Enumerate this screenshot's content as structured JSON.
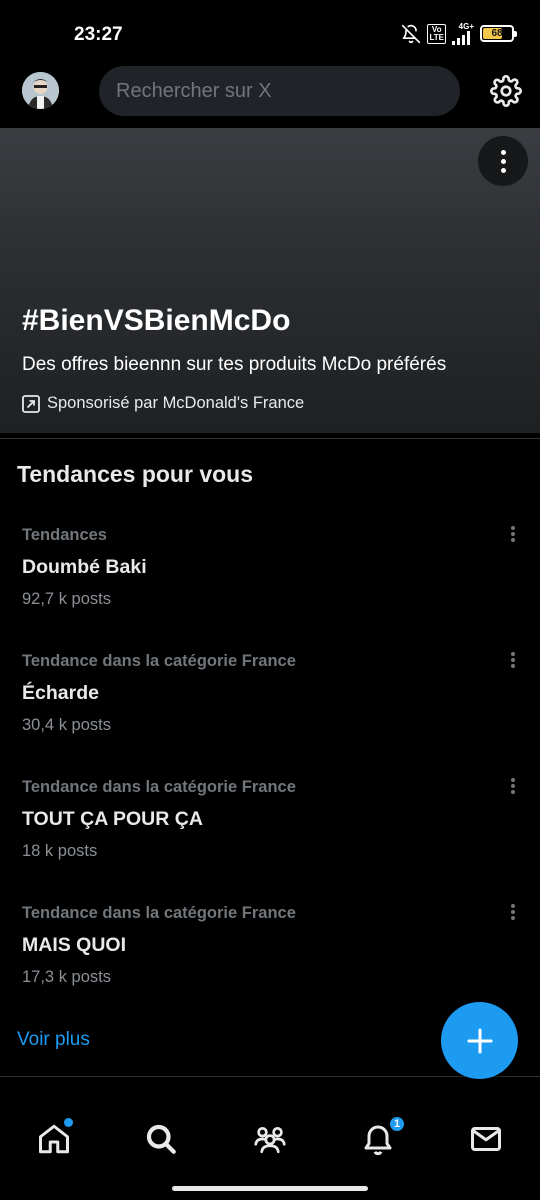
{
  "status_bar": {
    "time": "23:27",
    "volte_label": "Vo\nLTE",
    "network_label": "4G+",
    "battery_level": "68",
    "battery_fraction": 0.68,
    "icons": [
      "mute-bell-icon",
      "signal-icon",
      "battery-icon"
    ]
  },
  "header": {
    "search_placeholder": "Rechercher sur X",
    "settings_icon": "gear-icon"
  },
  "promo": {
    "hashtag": "#BienVSBienMcDo",
    "description": "Des offres bieennn sur tes produits McDo préférés",
    "sponsor": "Sponsorisé par McDonald's France"
  },
  "trends": {
    "title": "Tendances pour vous",
    "items": [
      {
        "category": "Tendances",
        "name": "Doumbé Baki",
        "count": "92,7 k posts"
      },
      {
        "category": "Tendance dans la catégorie France",
        "name": "Écharde",
        "count": "30,4 k posts"
      },
      {
        "category": "Tendance dans la catégorie France",
        "name": "TOUT ÇA POUR ÇA",
        "count": "18 k posts"
      },
      {
        "category": "Tendance dans la catégorie France",
        "name": "MAIS QUOI",
        "count": "17,3 k posts"
      }
    ],
    "see_more": "Voir plus"
  },
  "nav": {
    "notifications_badge": "1",
    "items": [
      "home-icon",
      "search-icon",
      "communities-icon",
      "notifications-icon",
      "messages-icon"
    ]
  },
  "colors": {
    "accent": "#1d9bf0",
    "background": "#000000",
    "secondary_text": "#71767b"
  }
}
